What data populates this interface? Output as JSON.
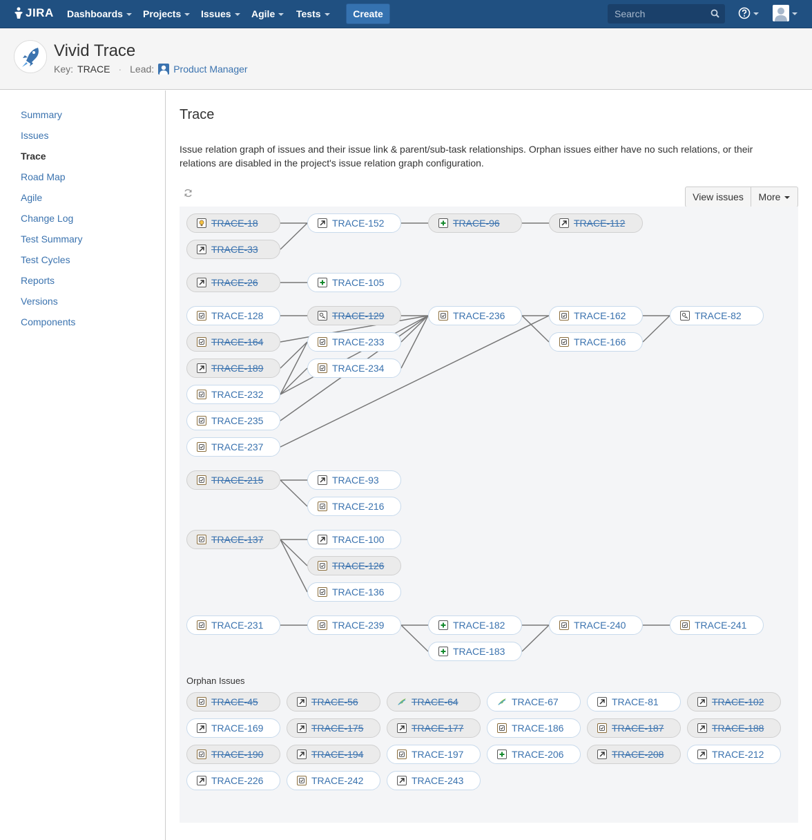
{
  "nav": {
    "logo": "JIRA",
    "items": [
      "Dashboards",
      "Projects",
      "Issues",
      "Agile",
      "Tests"
    ],
    "create": "Create",
    "search_placeholder": "Search"
  },
  "project": {
    "name": "Vivid Trace",
    "key_label": "Key:",
    "key": "TRACE",
    "lead_label": "Lead:",
    "lead": "Product Manager"
  },
  "sidebar": {
    "items": [
      "Summary",
      "Issues",
      "Trace",
      "Road Map",
      "Agile",
      "Change Log",
      "Test Summary",
      "Test Cycles",
      "Reports",
      "Versions",
      "Components"
    ],
    "active": "Trace"
  },
  "page": {
    "title": "Trace",
    "description": "Issue relation graph of issues and their issue link & parent/sub-task relationships. Orphan issues either have no such relations, or their relations are disabled in the project's issue relation graph configuration.",
    "view_issues": "View issues",
    "more": "More",
    "orphan_title": "Orphan Issues"
  },
  "colors": {
    "nav_bg": "#205081",
    "link": "#3b73af",
    "graph_bg": "#f4f5f7",
    "create_btn": "#3572b0"
  },
  "graph_nodes": [
    {
      "id": "TRACE-18",
      "icon": "improvement-icon",
      "resolved": true
    },
    {
      "id": "TRACE-33",
      "icon": "task-icon",
      "resolved": true
    },
    {
      "id": "TRACE-152",
      "icon": "task-icon",
      "resolved": false
    },
    {
      "id": "TRACE-96",
      "icon": "new-feature-icon",
      "resolved": true
    },
    {
      "id": "TRACE-112",
      "icon": "task-icon",
      "resolved": true
    },
    {
      "id": "TRACE-26",
      "icon": "task-icon",
      "resolved": true
    },
    {
      "id": "TRACE-105",
      "icon": "new-feature-icon",
      "resolved": false
    },
    {
      "id": "TRACE-128",
      "icon": "requirement-icon",
      "resolved": false
    },
    {
      "id": "TRACE-164",
      "icon": "requirement-icon",
      "resolved": true
    },
    {
      "id": "TRACE-189",
      "icon": "task-icon",
      "resolved": true
    },
    {
      "id": "TRACE-232",
      "icon": "requirement-icon",
      "resolved": false
    },
    {
      "id": "TRACE-235",
      "icon": "requirement-icon",
      "resolved": false
    },
    {
      "id": "TRACE-237",
      "icon": "requirement-icon",
      "resolved": false
    },
    {
      "id": "TRACE-129",
      "icon": "test-icon",
      "resolved": true
    },
    {
      "id": "TRACE-233",
      "icon": "requirement-icon",
      "resolved": false
    },
    {
      "id": "TRACE-234",
      "icon": "requirement-icon",
      "resolved": false
    },
    {
      "id": "TRACE-236",
      "icon": "requirement-icon",
      "resolved": false
    },
    {
      "id": "TRACE-162",
      "icon": "requirement-icon",
      "resolved": false
    },
    {
      "id": "TRACE-166",
      "icon": "requirement-icon",
      "resolved": false
    },
    {
      "id": "TRACE-82",
      "icon": "test-icon",
      "resolved": false
    },
    {
      "id": "TRACE-215",
      "icon": "requirement-icon",
      "resolved": true
    },
    {
      "id": "TRACE-93",
      "icon": "task-icon",
      "resolved": false
    },
    {
      "id": "TRACE-216",
      "icon": "requirement-icon",
      "resolved": false
    },
    {
      "id": "TRACE-137",
      "icon": "requirement-icon",
      "resolved": true
    },
    {
      "id": "TRACE-100",
      "icon": "task-icon",
      "resolved": false
    },
    {
      "id": "TRACE-126",
      "icon": "requirement-icon",
      "resolved": true
    },
    {
      "id": "TRACE-136",
      "icon": "requirement-icon",
      "resolved": false
    },
    {
      "id": "TRACE-231",
      "icon": "requirement-icon",
      "resolved": false
    },
    {
      "id": "TRACE-239",
      "icon": "requirement-icon",
      "resolved": false
    },
    {
      "id": "TRACE-182",
      "icon": "new-feature-icon",
      "resolved": false
    },
    {
      "id": "TRACE-183",
      "icon": "new-feature-icon",
      "resolved": false
    },
    {
      "id": "TRACE-240",
      "icon": "requirement-icon",
      "resolved": false
    },
    {
      "id": "TRACE-241",
      "icon": "requirement-icon",
      "resolved": false
    }
  ],
  "graph_links": [
    [
      "TRACE-18",
      "TRACE-152"
    ],
    [
      "TRACE-33",
      "TRACE-152"
    ],
    [
      "TRACE-152",
      "TRACE-96"
    ],
    [
      "TRACE-96",
      "TRACE-112"
    ],
    [
      "TRACE-26",
      "TRACE-105"
    ],
    [
      "TRACE-128",
      "TRACE-129"
    ],
    [
      "TRACE-129",
      "TRACE-236"
    ],
    [
      "TRACE-164",
      "TRACE-236"
    ],
    [
      "TRACE-233",
      "TRACE-236"
    ],
    [
      "TRACE-234",
      "TRACE-236"
    ],
    [
      "TRACE-189",
      "TRACE-233"
    ],
    [
      "TRACE-232",
      "TRACE-233"
    ],
    [
      "TRACE-232",
      "TRACE-234"
    ],
    [
      "TRACE-232",
      "TRACE-236"
    ],
    [
      "TRACE-235",
      "TRACE-236"
    ],
    [
      "TRACE-236",
      "TRACE-162"
    ],
    [
      "TRACE-236",
      "TRACE-166"
    ],
    [
      "TRACE-237",
      "TRACE-162"
    ],
    [
      "TRACE-162",
      "TRACE-82"
    ],
    [
      "TRACE-166",
      "TRACE-82"
    ],
    [
      "TRACE-215",
      "TRACE-93"
    ],
    [
      "TRACE-215",
      "TRACE-216"
    ],
    [
      "TRACE-137",
      "TRACE-100"
    ],
    [
      "TRACE-137",
      "TRACE-126"
    ],
    [
      "TRACE-137",
      "TRACE-136"
    ],
    [
      "TRACE-231",
      "TRACE-239"
    ],
    [
      "TRACE-239",
      "TRACE-182"
    ],
    [
      "TRACE-239",
      "TRACE-183"
    ],
    [
      "TRACE-182",
      "TRACE-240"
    ],
    [
      "TRACE-183",
      "TRACE-240"
    ],
    [
      "TRACE-240",
      "TRACE-241"
    ]
  ],
  "orphans": [
    {
      "id": "TRACE-45",
      "icon": "requirement-icon",
      "resolved": true
    },
    {
      "id": "TRACE-56",
      "icon": "task-icon",
      "resolved": true
    },
    {
      "id": "TRACE-64",
      "icon": "epic-icon",
      "resolved": true
    },
    {
      "id": "TRACE-67",
      "icon": "epic-icon",
      "resolved": false
    },
    {
      "id": "TRACE-81",
      "icon": "task-icon",
      "resolved": false
    },
    {
      "id": "TRACE-102",
      "icon": "task-icon",
      "resolved": true
    },
    {
      "id": "TRACE-169",
      "icon": "task-icon",
      "resolved": false
    },
    {
      "id": "TRACE-175",
      "icon": "task-icon",
      "resolved": true
    },
    {
      "id": "TRACE-177",
      "icon": "task-icon",
      "resolved": true
    },
    {
      "id": "TRACE-186",
      "icon": "requirement-icon",
      "resolved": false
    },
    {
      "id": "TRACE-187",
      "icon": "requirement-icon",
      "resolved": true
    },
    {
      "id": "TRACE-188",
      "icon": "task-icon",
      "resolved": true
    },
    {
      "id": "TRACE-190",
      "icon": "requirement-icon",
      "resolved": true
    },
    {
      "id": "TRACE-194",
      "icon": "task-icon",
      "resolved": true
    },
    {
      "id": "TRACE-197",
      "icon": "requirement-icon",
      "resolved": false
    },
    {
      "id": "TRACE-206",
      "icon": "new-feature-icon",
      "resolved": false
    },
    {
      "id": "TRACE-208",
      "icon": "task-icon",
      "resolved": true
    },
    {
      "id": "TRACE-212",
      "icon": "task-icon",
      "resolved": false
    },
    {
      "id": "TRACE-226",
      "icon": "task-icon",
      "resolved": false
    },
    {
      "id": "TRACE-242",
      "icon": "requirement-icon",
      "resolved": false
    },
    {
      "id": "TRACE-243",
      "icon": "task-icon",
      "resolved": false
    }
  ]
}
